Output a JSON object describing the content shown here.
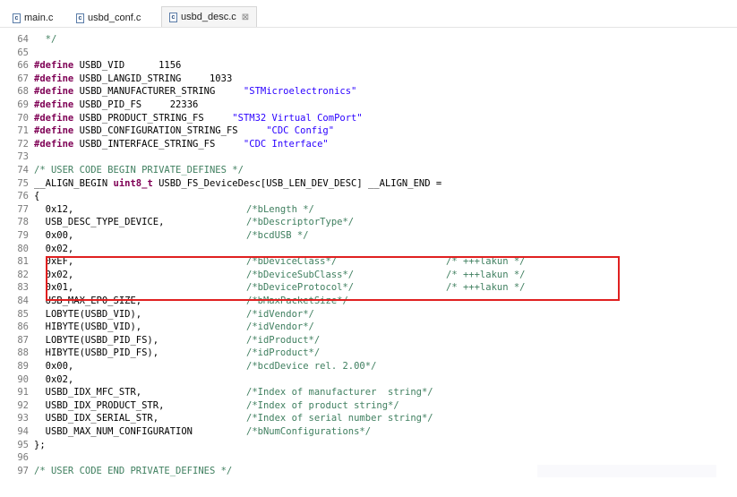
{
  "tabs": [
    {
      "name": "main.c",
      "active": false
    },
    {
      "name": "usbd_conf.c",
      "active": false
    },
    {
      "name": "usbd_desc.c",
      "active": true,
      "close_glyph": "⊠"
    }
  ],
  "colors": {
    "keyword": "#7f0055",
    "string": "#2a00ff",
    "comment": "#3f7f5f",
    "highlight_box": "#e02020"
  },
  "lines": [
    {
      "n": "64",
      "parts": [
        {
          "t": "  */",
          "c": "com"
        }
      ]
    },
    {
      "n": "65",
      "parts": []
    },
    {
      "n": "66",
      "parts": [
        {
          "t": "#define",
          "c": "kw"
        },
        {
          "t": " USBD_VID      1156",
          "c": ""
        }
      ]
    },
    {
      "n": "67",
      "parts": [
        {
          "t": "#define",
          "c": "kw"
        },
        {
          "t": " USBD_LANGID_STRING     1033",
          "c": ""
        }
      ]
    },
    {
      "n": "68",
      "parts": [
        {
          "t": "#define",
          "c": "kw"
        },
        {
          "t": " USBD_MANUFACTURER_STRING     ",
          "c": ""
        },
        {
          "t": "\"STMicroelectronics\"",
          "c": "str"
        }
      ]
    },
    {
      "n": "69",
      "parts": [
        {
          "t": "#define",
          "c": "kw"
        },
        {
          "t": " USBD_PID_FS     22336",
          "c": ""
        }
      ]
    },
    {
      "n": "70",
      "parts": [
        {
          "t": "#define",
          "c": "kw"
        },
        {
          "t": " USBD_PRODUCT_STRING_FS     ",
          "c": ""
        },
        {
          "t": "\"STM32 Virtual ComPort\"",
          "c": "str"
        }
      ]
    },
    {
      "n": "71",
      "parts": [
        {
          "t": "#define",
          "c": "kw"
        },
        {
          "t": " USBD_CONFIGURATION_STRING_FS     ",
          "c": ""
        },
        {
          "t": "\"CDC Config\"",
          "c": "str"
        }
      ]
    },
    {
      "n": "72",
      "parts": [
        {
          "t": "#define",
          "c": "kw"
        },
        {
          "t": " USBD_INTERFACE_STRING_FS     ",
          "c": ""
        },
        {
          "t": "\"CDC Interface\"",
          "c": "str"
        }
      ]
    },
    {
      "n": "73",
      "parts": []
    },
    {
      "n": "74",
      "parts": [
        {
          "t": "/* USER CODE BEGIN PRIVATE_DEFINES */",
          "c": "com"
        }
      ]
    },
    {
      "n": "75",
      "parts": [
        {
          "t": "__ALIGN_BEGIN ",
          "c": ""
        },
        {
          "t": "uint8_t",
          "c": "kw"
        },
        {
          "t": " USBD_FS_DeviceDesc[USB_LEN_DEV_DESC] __ALIGN_END =",
          "c": ""
        }
      ]
    },
    {
      "n": "76",
      "parts": [
        {
          "t": "{",
          "c": ""
        }
      ]
    },
    {
      "n": "77",
      "parts": [
        {
          "t": "  0x12,",
          "c": ""
        }
      ],
      "comment": "/*bLength */"
    },
    {
      "n": "78",
      "parts": [
        {
          "t": "  USB_DESC_TYPE_DEVICE,",
          "c": ""
        }
      ],
      "comment": "/*bDescriptorType*/"
    },
    {
      "n": "79",
      "parts": [
        {
          "t": "  0x00,",
          "c": ""
        }
      ],
      "comment": "/*bcdUSB */"
    },
    {
      "n": "80",
      "parts": [
        {
          "t": "  0x02,",
          "c": ""
        }
      ]
    },
    {
      "n": "81",
      "parts": [
        {
          "t": "  0xEF,",
          "c": ""
        }
      ],
      "comment": "/*bDeviceClass*/",
      "extra": "/* +++lakun */"
    },
    {
      "n": "82",
      "parts": [
        {
          "t": "  0x02,",
          "c": ""
        }
      ],
      "comment": "/*bDeviceSubClass*/",
      "extra": "/* +++lakun */"
    },
    {
      "n": "83",
      "parts": [
        {
          "t": "  0x01,",
          "c": ""
        }
      ],
      "comment": "/*bDeviceProtocol*/",
      "extra": "/* +++lakun */"
    },
    {
      "n": "84",
      "parts": [
        {
          "t": "  USB_MAX_EP0_SIZE,",
          "c": ""
        }
      ],
      "comment": "/*bMaxPacketSize*/"
    },
    {
      "n": "85",
      "parts": [
        {
          "t": "  LOBYTE(USBD_VID),",
          "c": ""
        }
      ],
      "comment": "/*idVendor*/"
    },
    {
      "n": "86",
      "parts": [
        {
          "t": "  HIBYTE(USBD_VID),",
          "c": ""
        }
      ],
      "comment": "/*idVendor*/"
    },
    {
      "n": "87",
      "parts": [
        {
          "t": "  LOBYTE(USBD_PID_FS),",
          "c": ""
        }
      ],
      "comment": "/*idProduct*/"
    },
    {
      "n": "88",
      "parts": [
        {
          "t": "  HIBYTE(USBD_PID_FS),",
          "c": ""
        }
      ],
      "comment": "/*idProduct*/"
    },
    {
      "n": "89",
      "parts": [
        {
          "t": "  0x00,",
          "c": ""
        }
      ],
      "comment": "/*bcdDevice rel. 2.00*/"
    },
    {
      "n": "90",
      "parts": [
        {
          "t": "  0x02,",
          "c": ""
        }
      ]
    },
    {
      "n": "91",
      "parts": [
        {
          "t": "  USBD_IDX_MFC_STR,",
          "c": ""
        }
      ],
      "comment": "/*Index of manufacturer  string*/"
    },
    {
      "n": "92",
      "parts": [
        {
          "t": "  USBD_IDX_PRODUCT_STR,",
          "c": ""
        }
      ],
      "comment": "/*Index of product string*/"
    },
    {
      "n": "93",
      "parts": [
        {
          "t": "  USBD_IDX_SERIAL_STR,",
          "c": ""
        }
      ],
      "comment": "/*Index of serial number string*/"
    },
    {
      "n": "94",
      "parts": [
        {
          "t": "  USBD_MAX_NUM_CONFIGURATION",
          "c": ""
        }
      ],
      "comment": "/*bNumConfigurations*/"
    },
    {
      "n": "95",
      "parts": [
        {
          "t": "};",
          "c": ""
        }
      ]
    },
    {
      "n": "96",
      "parts": []
    },
    {
      "n": "97",
      "parts": [
        {
          "t": "/* USER CODE END PRIVATE_DEFINES */",
          "c": "com"
        }
      ]
    }
  ]
}
